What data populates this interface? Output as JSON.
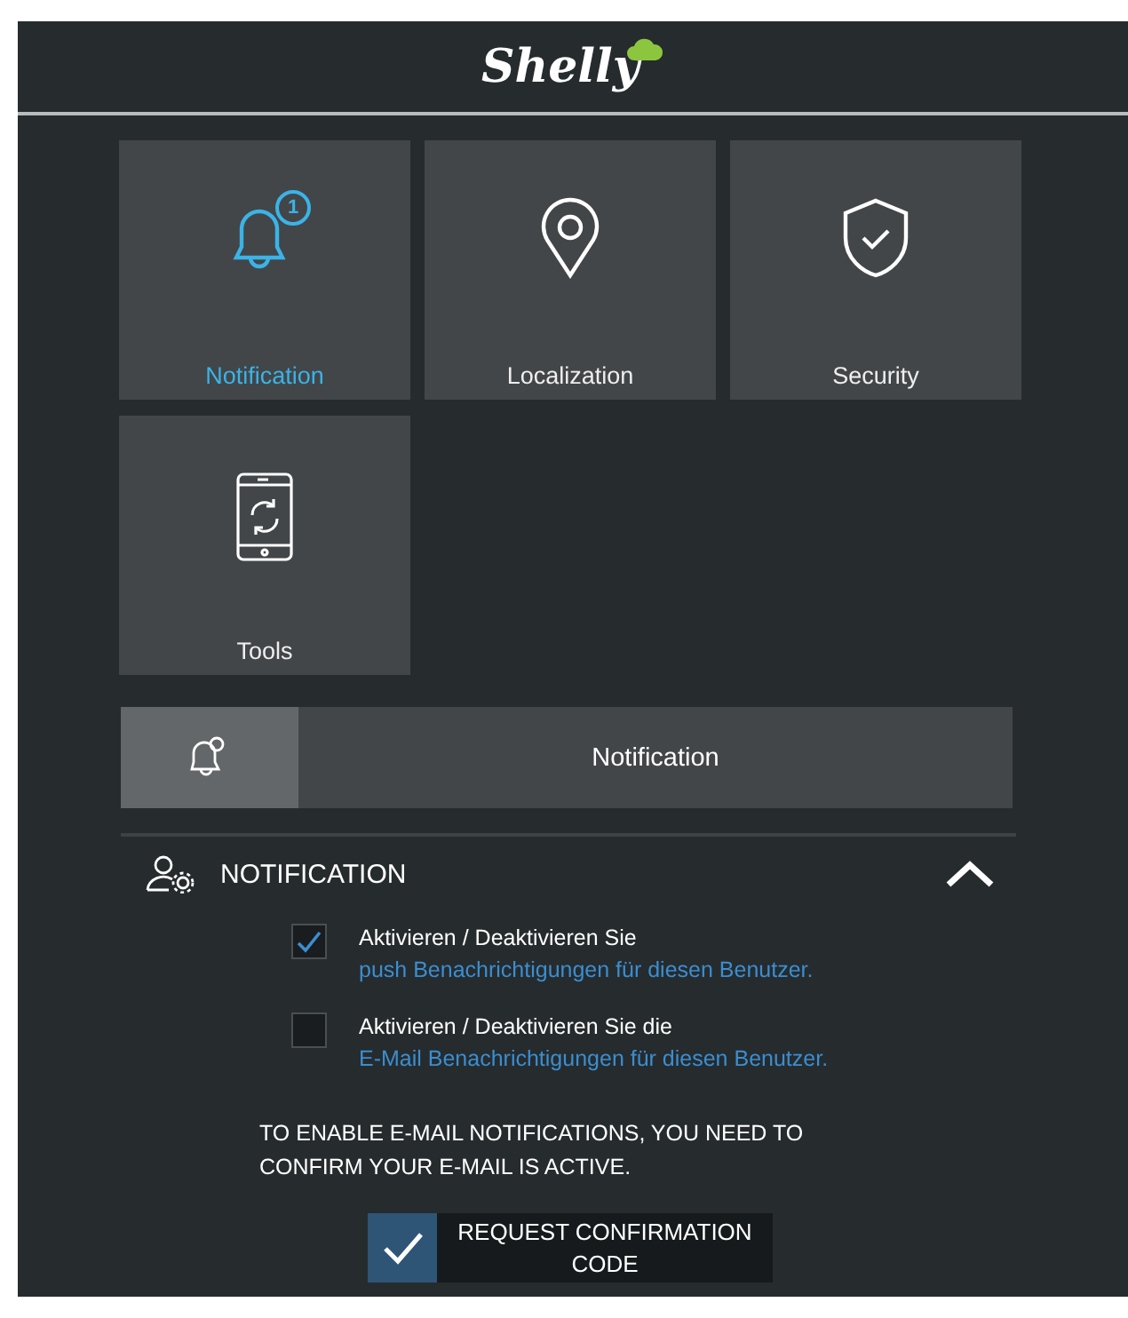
{
  "header": {
    "logo": "Shelly"
  },
  "tiles": [
    {
      "kind": "bell",
      "label": "Notification",
      "selected": true,
      "badge": "1"
    },
    {
      "kind": "pin",
      "label": "Localization",
      "selected": false
    },
    {
      "kind": "shield",
      "label": "Security",
      "selected": false
    },
    {
      "kind": "phone",
      "label": "Tools",
      "selected": false
    }
  ],
  "page_bar": {
    "title": "Notification"
  },
  "section": {
    "title": "NOTIFICATION",
    "expanded": true,
    "options": [
      {
        "text": "Aktivieren / Deaktivieren Sie",
        "link": "push Benachrichtigungen für diesen Benutzer.",
        "checked": true
      },
      {
        "text": "Aktivieren / Deaktivieren Sie die",
        "link": "E-Mail Benachrichtigungen für diesen Benutzer.",
        "checked": false
      }
    ],
    "info": "TO ENABLE E-MAIL NOTIFICATIONS, YOU NEED TO CONFIRM YOUR E-MAIL IS ACTIVE.",
    "button": "REQUEST CONFIRMATION CODE"
  }
}
